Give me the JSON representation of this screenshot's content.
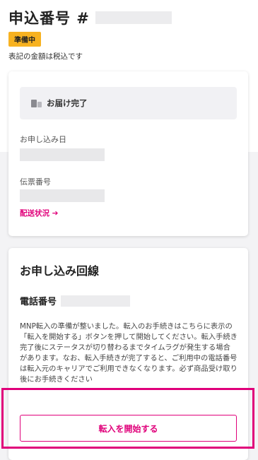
{
  "header": {
    "title": "申込番号 #",
    "status_badge": "準備中",
    "tax_note": "表記の金額は税込です"
  },
  "delivery": {
    "status_label": "お届け完了",
    "status_icon": "truck-icon",
    "application_date_label": "お申し込み日",
    "tracking_number_label": "伝票番号",
    "tracking_link_label": "配送状況 ➔"
  },
  "line": {
    "section_title": "お申し込み回線",
    "phone_label": "電話番号",
    "mnp_note": "MNP転入の準備が整いました。転入のお手続きはこちらに表示の「転入を開始する」ボタンを押して開始してください。転入手続き完了後にステータスが切り替わるまでタイムラグが発生する場合があります。なお、転入手続きが完了すると、ご利用中の電話番号は転入元のキャリアでご利用できなくなります。必ず商品受け取り後にお手続きください",
    "start_button_label": "転入を開始する"
  },
  "colors": {
    "accent": "#e0007a",
    "badge": "#f7b221"
  }
}
